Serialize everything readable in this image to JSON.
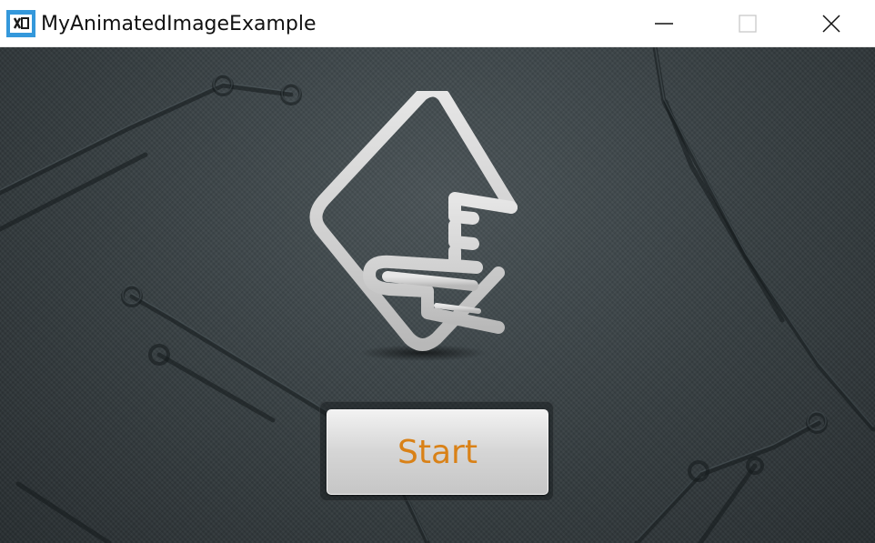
{
  "window": {
    "title": "MyAnimatedImageExample",
    "app_icon": "xamarin-app-icon",
    "controls": {
      "minimize_icon": "minimize-icon",
      "maximize_icon": "maximize-icon",
      "close_icon": "close-icon"
    }
  },
  "content": {
    "logo_icon": "ruler-hand-logo-icon",
    "start_button": {
      "label": "Start"
    }
  },
  "colors": {
    "titlebar": "#ffffff",
    "background": "#363e41",
    "button_text": "#d98117",
    "button_face": "#d5d5d5",
    "app_icon": "#3498db"
  }
}
